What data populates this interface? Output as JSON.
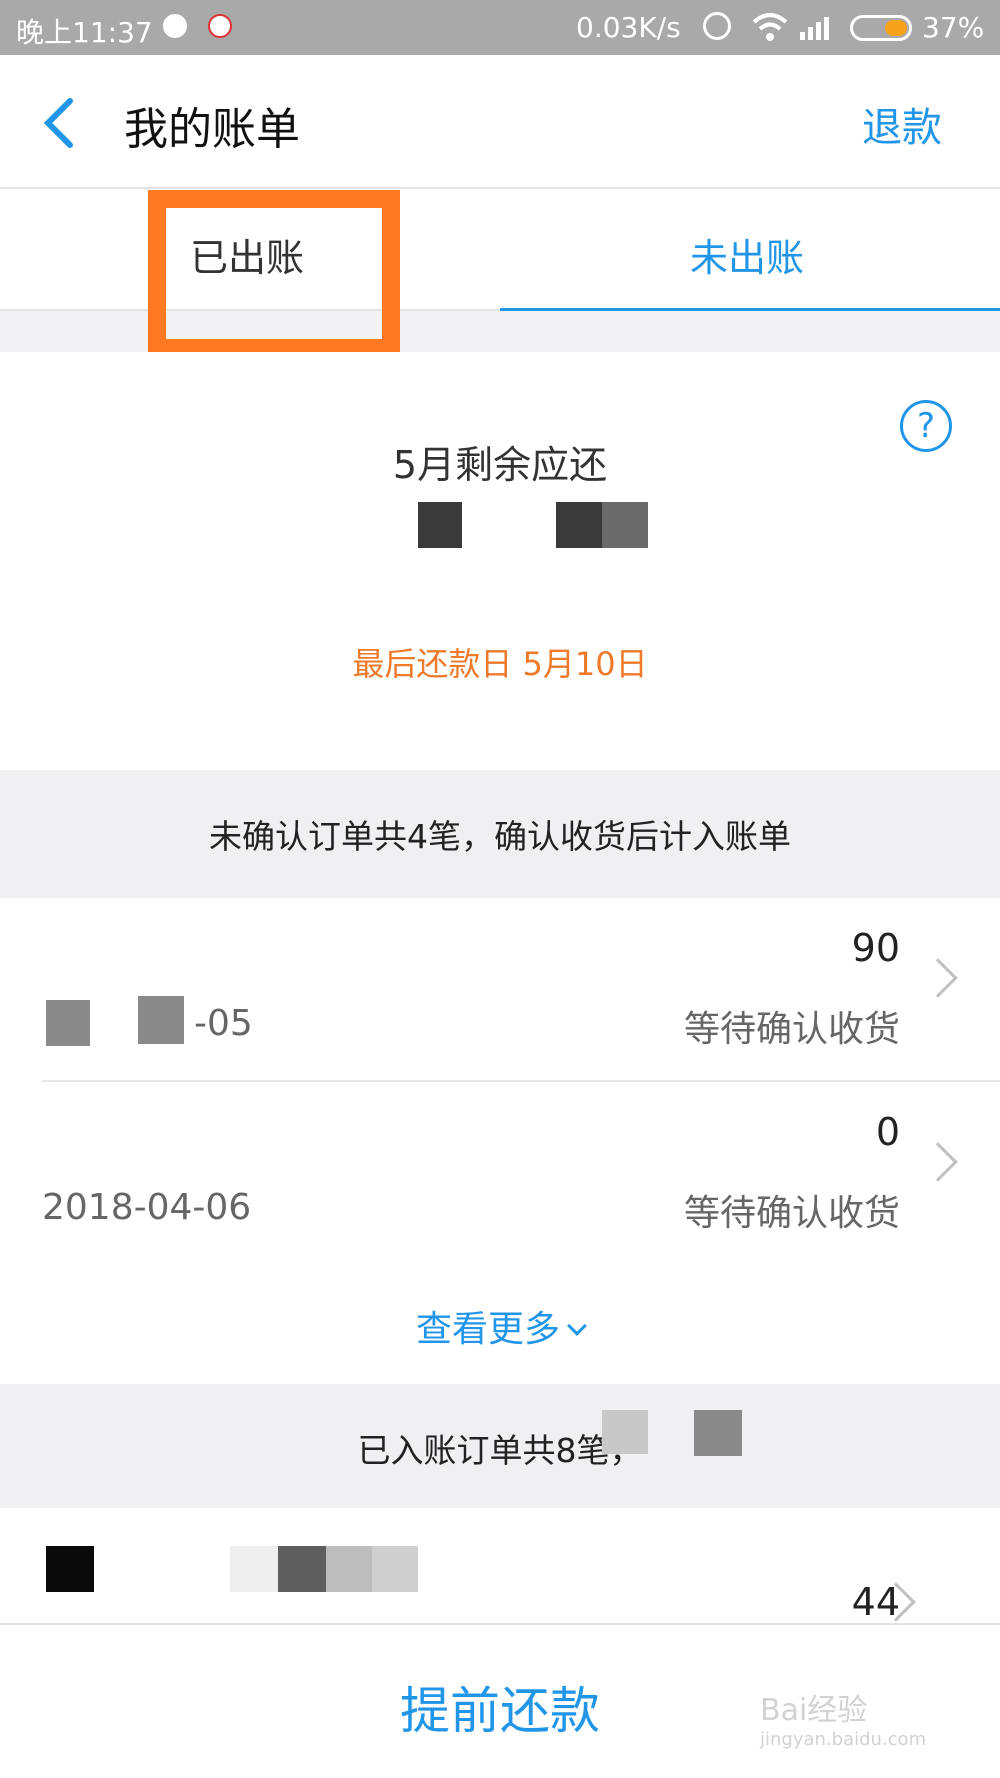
{
  "status_bar": {
    "time": "晚上11:37",
    "network_speed": "0.03K/s",
    "battery": "37%",
    "battery_level_percent": 37
  },
  "header": {
    "title": "我的账单",
    "right_action": "退款"
  },
  "tabs": [
    {
      "label": "已出账",
      "active": false
    },
    {
      "label": "未出账",
      "active": true
    }
  ],
  "summary": {
    "label": "5月剩余应还",
    "due_date": "最后还款日 5月10日"
  },
  "unconfirmed_section": {
    "notice": "未确认订单共4笔，确认收货后计入账单",
    "items": [
      {
        "date": "-05",
        "amount": "90",
        "status": "等待确认收货"
      },
      {
        "date": "2018-04-06",
        "amount": "0",
        "status": "等待确认收货"
      }
    ],
    "see_more": "查看更多"
  },
  "billed_section": {
    "notice": "已入账订单共8笔，",
    "items": [
      {
        "amount": "44"
      }
    ]
  },
  "bottom_button": "提前还款",
  "watermark": {
    "brand": "Bai经验",
    "url": "jingyan.baidu.com"
  },
  "colors": {
    "accent": "#2196e8",
    "warning": "#ee7a2a",
    "highlight": "#ff7922"
  }
}
